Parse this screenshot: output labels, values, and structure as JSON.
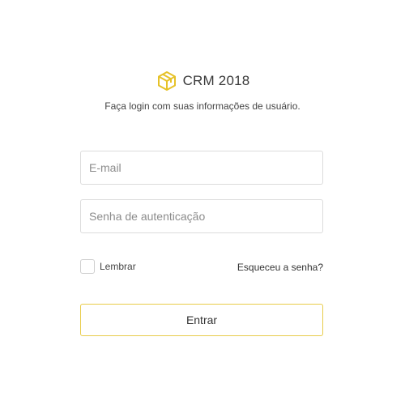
{
  "brand": {
    "name": "CRM 2018",
    "logo_icon": "cube-icon",
    "accent_color": "#e6c229"
  },
  "login": {
    "subtitle": "Faça login com suas informações de usuário.",
    "email_placeholder": "E-mail",
    "password_placeholder": "Senha de autenticação",
    "remember_label": "Lembrar",
    "remember_checked": false,
    "forgot_label": "Esqueceu a senha?",
    "submit_label": "Entrar"
  }
}
